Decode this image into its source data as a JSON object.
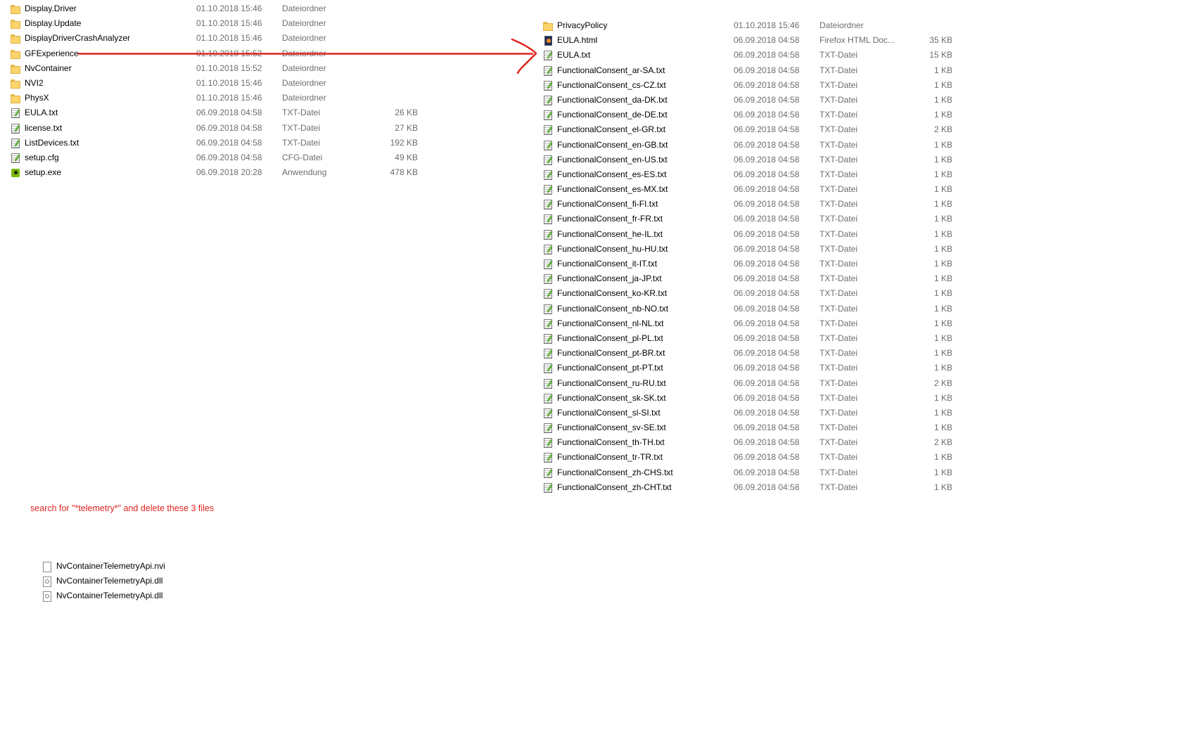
{
  "left_pane": {
    "files": [
      {
        "name": "Display.Driver",
        "date": "01.10.2018 15:46",
        "type": "Dateiordner",
        "size": "",
        "icon": "folder-icon"
      },
      {
        "name": "Display.Update",
        "date": "01.10.2018 15:46",
        "type": "Dateiordner",
        "size": "",
        "icon": "folder-icon"
      },
      {
        "name": "DisplayDriverCrashAnalyzer",
        "date": "01.10.2018 15:46",
        "type": "Dateiordner",
        "size": "",
        "icon": "folder-icon"
      },
      {
        "name": "GFExperience",
        "date": "01.10.2018 15:52",
        "type": "Dateiordner",
        "size": "",
        "icon": "folder-icon"
      },
      {
        "name": "NvContainer",
        "date": "01.10.2018 15:52",
        "type": "Dateiordner",
        "size": "",
        "icon": "folder-icon"
      },
      {
        "name": "NVI2",
        "date": "01.10.2018 15:46",
        "type": "Dateiordner",
        "size": "",
        "icon": "folder-icon"
      },
      {
        "name": "PhysX",
        "date": "01.10.2018 15:46",
        "type": "Dateiordner",
        "size": "",
        "icon": "folder-icon"
      },
      {
        "name": "EULA.txt",
        "date": "06.09.2018 04:58",
        "type": "TXT-Datei",
        "size": "26 KB",
        "icon": "text-file-icon"
      },
      {
        "name": "license.txt",
        "date": "06.09.2018 04:58",
        "type": "TXT-Datei",
        "size": "27 KB",
        "icon": "text-file-icon"
      },
      {
        "name": "ListDevices.txt",
        "date": "06.09.2018 04:58",
        "type": "TXT-Datei",
        "size": "192 KB",
        "icon": "text-file-icon"
      },
      {
        "name": "setup.cfg",
        "date": "06.09.2018 04:58",
        "type": "CFG-Datei",
        "size": "49 KB",
        "icon": "text-file-icon"
      },
      {
        "name": "setup.exe",
        "date": "06.09.2018 20:28",
        "type": "Anwendung",
        "size": "478 KB",
        "icon": "application-icon"
      }
    ]
  },
  "right_pane": {
    "files": [
      {
        "name": "PrivacyPolicy",
        "date": "01.10.2018 15:46",
        "type": "Dateiordner",
        "size": "",
        "icon": "folder-icon"
      },
      {
        "name": "EULA.html",
        "date": "06.09.2018 04:58",
        "type": "Firefox HTML Doc...",
        "size": "35 KB",
        "icon": "firefox-html-icon"
      },
      {
        "name": "EULA.txt",
        "date": "06.09.2018 04:58",
        "type": "TXT-Datei",
        "size": "15 KB",
        "icon": "text-file-icon"
      },
      {
        "name": "FunctionalConsent_ar-SA.txt",
        "date": "06.09.2018 04:58",
        "type": "TXT-Datei",
        "size": "1 KB",
        "icon": "text-file-icon"
      },
      {
        "name": "FunctionalConsent_cs-CZ.txt",
        "date": "06.09.2018 04:58",
        "type": "TXT-Datei",
        "size": "1 KB",
        "icon": "text-file-icon"
      },
      {
        "name": "FunctionalConsent_da-DK.txt",
        "date": "06.09.2018 04:58",
        "type": "TXT-Datei",
        "size": "1 KB",
        "icon": "text-file-icon"
      },
      {
        "name": "FunctionalConsent_de-DE.txt",
        "date": "06.09.2018 04:58",
        "type": "TXT-Datei",
        "size": "1 KB",
        "icon": "text-file-icon"
      },
      {
        "name": "FunctionalConsent_el-GR.txt",
        "date": "06.09.2018 04:58",
        "type": "TXT-Datei",
        "size": "2 KB",
        "icon": "text-file-icon"
      },
      {
        "name": "FunctionalConsent_en-GB.txt",
        "date": "06.09.2018 04:58",
        "type": "TXT-Datei",
        "size": "1 KB",
        "icon": "text-file-icon"
      },
      {
        "name": "FunctionalConsent_en-US.txt",
        "date": "06.09.2018 04:58",
        "type": "TXT-Datei",
        "size": "1 KB",
        "icon": "text-file-icon"
      },
      {
        "name": "FunctionalConsent_es-ES.txt",
        "date": "06.09.2018 04:58",
        "type": "TXT-Datei",
        "size": "1 KB",
        "icon": "text-file-icon"
      },
      {
        "name": "FunctionalConsent_es-MX.txt",
        "date": "06.09.2018 04:58",
        "type": "TXT-Datei",
        "size": "1 KB",
        "icon": "text-file-icon"
      },
      {
        "name": "FunctionalConsent_fi-FI.txt",
        "date": "06.09.2018 04:58",
        "type": "TXT-Datei",
        "size": "1 KB",
        "icon": "text-file-icon"
      },
      {
        "name": "FunctionalConsent_fr-FR.txt",
        "date": "06.09.2018 04:58",
        "type": "TXT-Datei",
        "size": "1 KB",
        "icon": "text-file-icon"
      },
      {
        "name": "FunctionalConsent_he-IL.txt",
        "date": "06.09.2018 04:58",
        "type": "TXT-Datei",
        "size": "1 KB",
        "icon": "text-file-icon"
      },
      {
        "name": "FunctionalConsent_hu-HU.txt",
        "date": "06.09.2018 04:58",
        "type": "TXT-Datei",
        "size": "1 KB",
        "icon": "text-file-icon"
      },
      {
        "name": "FunctionalConsent_it-IT.txt",
        "date": "06.09.2018 04:58",
        "type": "TXT-Datei",
        "size": "1 KB",
        "icon": "text-file-icon"
      },
      {
        "name": "FunctionalConsent_ja-JP.txt",
        "date": "06.09.2018 04:58",
        "type": "TXT-Datei",
        "size": "1 KB",
        "icon": "text-file-icon"
      },
      {
        "name": "FunctionalConsent_ko-KR.txt",
        "date": "06.09.2018 04:58",
        "type": "TXT-Datei",
        "size": "1 KB",
        "icon": "text-file-icon"
      },
      {
        "name": "FunctionalConsent_nb-NO.txt",
        "date": "06.09.2018 04:58",
        "type": "TXT-Datei",
        "size": "1 KB",
        "icon": "text-file-icon"
      },
      {
        "name": "FunctionalConsent_nl-NL.txt",
        "date": "06.09.2018 04:58",
        "type": "TXT-Datei",
        "size": "1 KB",
        "icon": "text-file-icon"
      },
      {
        "name": "FunctionalConsent_pl-PL.txt",
        "date": "06.09.2018 04:58",
        "type": "TXT-Datei",
        "size": "1 KB",
        "icon": "text-file-icon"
      },
      {
        "name": "FunctionalConsent_pt-BR.txt",
        "date": "06.09.2018 04:58",
        "type": "TXT-Datei",
        "size": "1 KB",
        "icon": "text-file-icon"
      },
      {
        "name": "FunctionalConsent_pt-PT.txt",
        "date": "06.09.2018 04:58",
        "type": "TXT-Datei",
        "size": "1 KB",
        "icon": "text-file-icon"
      },
      {
        "name": "FunctionalConsent_ru-RU.txt",
        "date": "06.09.2018 04:58",
        "type": "TXT-Datei",
        "size": "2 KB",
        "icon": "text-file-icon"
      },
      {
        "name": "FunctionalConsent_sk-SK.txt",
        "date": "06.09.2018 04:58",
        "type": "TXT-Datei",
        "size": "1 KB",
        "icon": "text-file-icon"
      },
      {
        "name": "FunctionalConsent_sl-SI.txt",
        "date": "06.09.2018 04:58",
        "type": "TXT-Datei",
        "size": "1 KB",
        "icon": "text-file-icon"
      },
      {
        "name": "FunctionalConsent_sv-SE.txt",
        "date": "06.09.2018 04:58",
        "type": "TXT-Datei",
        "size": "1 KB",
        "icon": "text-file-icon"
      },
      {
        "name": "FunctionalConsent_th-TH.txt",
        "date": "06.09.2018 04:58",
        "type": "TXT-Datei",
        "size": "2 KB",
        "icon": "text-file-icon"
      },
      {
        "name": "FunctionalConsent_tr-TR.txt",
        "date": "06.09.2018 04:58",
        "type": "TXT-Datei",
        "size": "1 KB",
        "icon": "text-file-icon"
      },
      {
        "name": "FunctionalConsent_zh-CHS.txt",
        "date": "06.09.2018 04:58",
        "type": "TXT-Datei",
        "size": "1 KB",
        "icon": "text-file-icon"
      },
      {
        "name": "FunctionalConsent_zh-CHT.txt",
        "date": "06.09.2018 04:58",
        "type": "TXT-Datei",
        "size": "1 KB",
        "icon": "text-file-icon"
      }
    ]
  },
  "annotation": {
    "text": "search for \"*telemetry*\" and delete these 3 files",
    "color": "#e0241f"
  },
  "telemetry_files": [
    {
      "name": "NvContainerTelemetryApi.nvi",
      "icon": "blank-file-icon"
    },
    {
      "name": "NvContainerTelemetryApi.dll",
      "icon": "dll-file-icon"
    },
    {
      "name": "NvContainerTelemetryApi.dll",
      "icon": "dll-file-icon"
    }
  ]
}
